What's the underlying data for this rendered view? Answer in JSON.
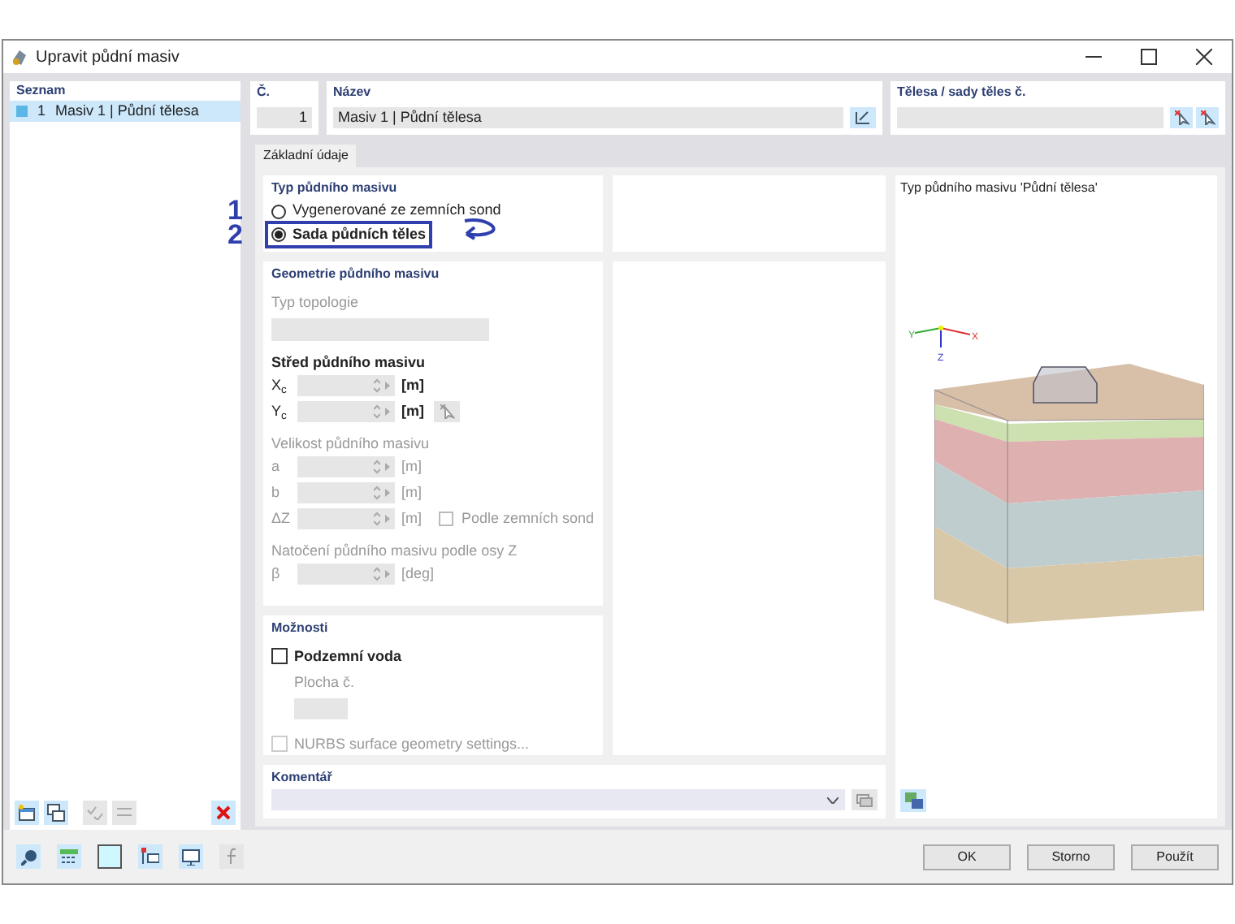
{
  "window": {
    "title": "Upravit půdní masiv"
  },
  "list": {
    "heading": "Seznam",
    "items": [
      {
        "number": "1",
        "label": "Masiv 1 | Půdní tělesa",
        "selected": true
      }
    ]
  },
  "number_field": {
    "label": "Č.",
    "value": "1"
  },
  "name_field": {
    "label": "Název",
    "value": "Masiv 1 | Půdní tělesa"
  },
  "bodies_field": {
    "label": "Tělesa / sady těles č."
  },
  "tabs": [
    {
      "label": "Základní údaje",
      "selected": true
    }
  ],
  "type_section": {
    "title": "Typ půdního masivu",
    "options": [
      {
        "label": "Vygenerované ze zemních sond",
        "selected": false,
        "marker": "1"
      },
      {
        "label": "Sada půdních těles",
        "selected": true,
        "marker": "2"
      }
    ]
  },
  "geometry": {
    "title": "Geometrie půdního masivu",
    "topology_label": "Typ topologie",
    "groups": [
      {
        "title": "Střed půdního masivu",
        "disabled": false,
        "pick": true,
        "rows": [
          {
            "label": "X$_{c}$",
            "unit": "[m]"
          },
          {
            "label": "Y$_{c}$",
            "unit": "[m]"
          }
        ]
      },
      {
        "title": "Velikost půdního masivu",
        "disabled": true,
        "rows": [
          {
            "label": "a",
            "unit": "[m]"
          },
          {
            "label": "b",
            "unit": "[m]"
          },
          {
            "label": "ΔZ",
            "unit": "[m]",
            "checkbox": {
              "label": "Podle zemních sond",
              "checked": false
            }
          }
        ]
      },
      {
        "title": "Natočení půdního masivu podle osy Z",
        "disabled": true,
        "rows": [
          {
            "label": "β",
            "unit": "[deg]"
          }
        ]
      }
    ]
  },
  "options": {
    "title": "Možnosti",
    "groundwater": {
      "label": "Podzemní voda",
      "checked": false
    },
    "area_label": "Plocha č.",
    "nurbs": {
      "label": "NURBS surface geometry settings...",
      "checked": false,
      "disabled": true
    }
  },
  "preview": {
    "title": "Typ půdního masivu 'Půdní tělesa'",
    "axes": [
      "Y",
      "X",
      "Z"
    ]
  },
  "comment": {
    "label": "Komentář"
  },
  "buttons": [
    "OK",
    "Storno",
    "Použít"
  ]
}
